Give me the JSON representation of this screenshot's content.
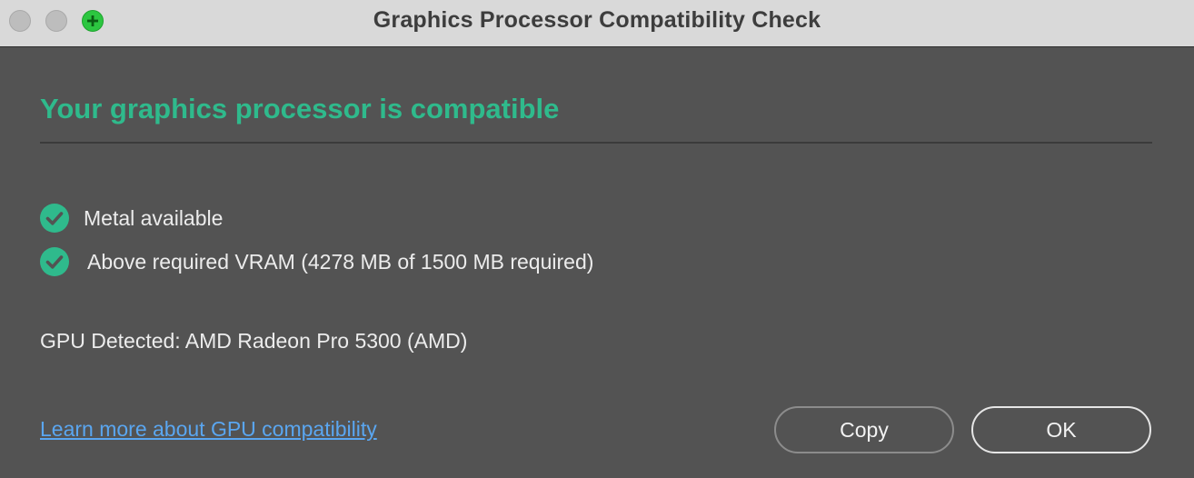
{
  "window": {
    "title": "Graphics Processor Compatibility Check"
  },
  "result": {
    "heading": "Your graphics processor is compatible",
    "checks": [
      {
        "label": "Metal available",
        "status": "pass"
      },
      {
        "label": "Above required VRAM (4278 MB of 1500 MB required)",
        "status": "pass"
      }
    ],
    "gpu_detected": "GPU Detected: AMD Radeon Pro 5300 (AMD)"
  },
  "footer": {
    "link_label": "Learn more about GPU compatibility",
    "copy_label": "Copy",
    "ok_label": "OK"
  },
  "colors": {
    "accent_green": "#2fba8c",
    "link_blue": "#5aa6f0",
    "background": "#535353",
    "titlebar": "#d9d9d9"
  }
}
